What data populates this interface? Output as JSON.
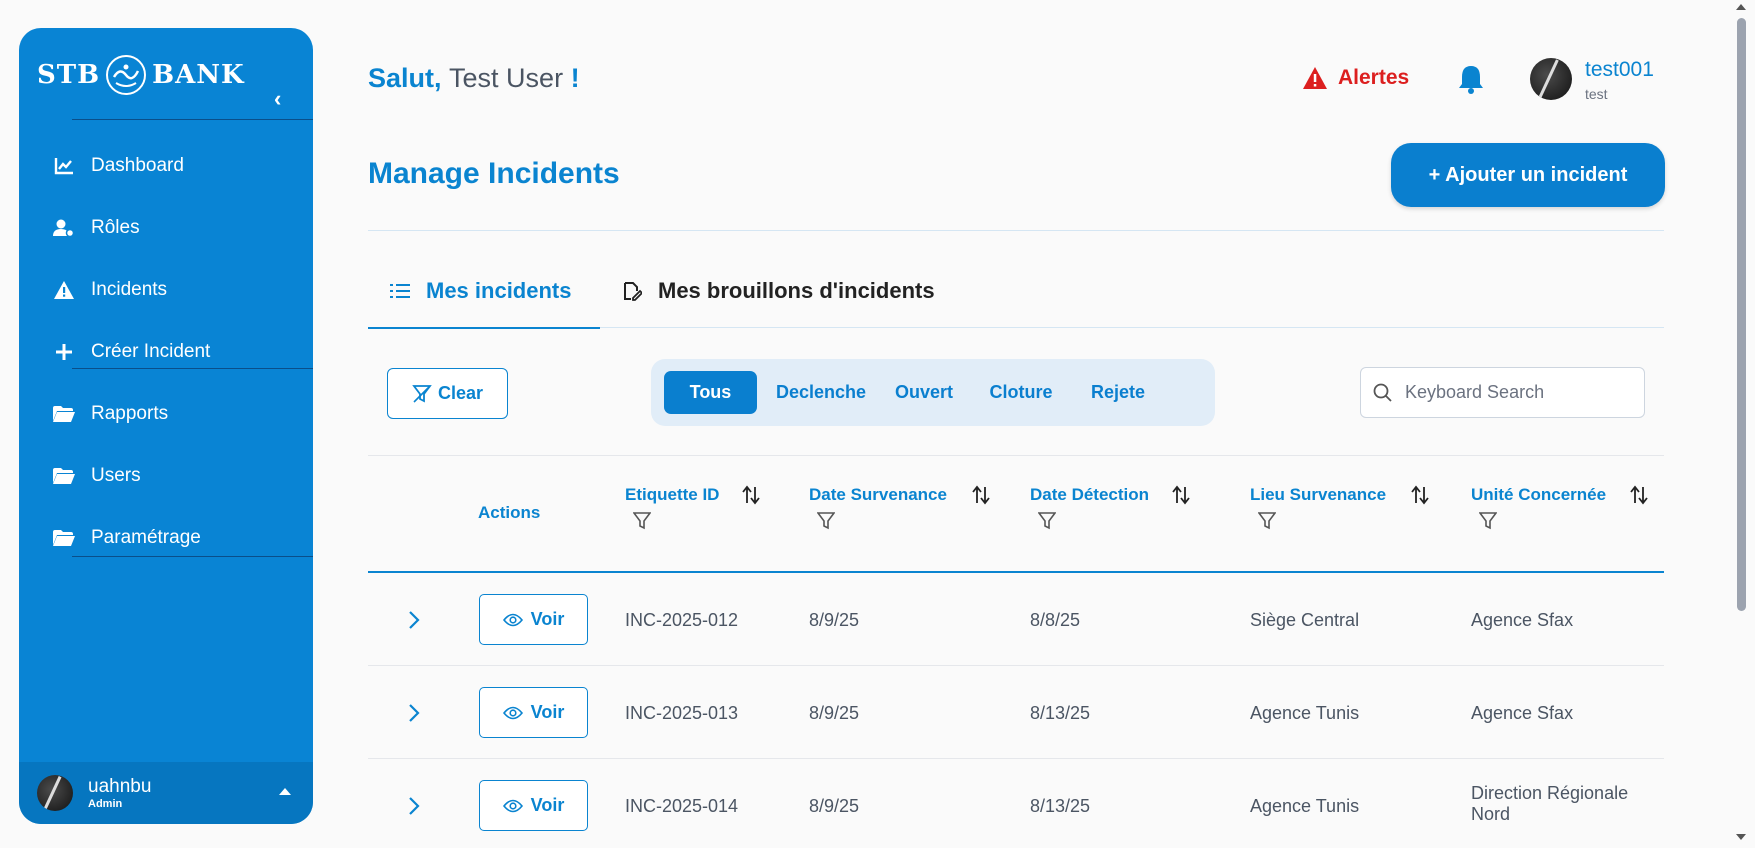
{
  "sidebar": {
    "logo_left": "STB",
    "logo_right": "BANK",
    "items": [
      {
        "label": "Dashboard",
        "icon": "chart-line-icon"
      },
      {
        "label": "Rôles",
        "icon": "user-gear-icon"
      },
      {
        "label": "Incidents",
        "icon": "warning-icon"
      },
      {
        "label": "Créer Incident",
        "icon": "plus-icon"
      },
      {
        "label": "Rapports",
        "icon": "folder-icon"
      },
      {
        "label": "Users",
        "icon": "folder-icon"
      },
      {
        "label": "Paramétrage",
        "icon": "folder-icon"
      }
    ],
    "footer": {
      "name": "uahnbu",
      "role": "Admin"
    }
  },
  "header": {
    "greeting": "Salut,",
    "user": "Test User",
    "exclaim": "!",
    "alerts_label": "Alertes",
    "profile_name": "test001",
    "profile_sub": "test"
  },
  "page": {
    "title": "Manage Incidents",
    "add_label": "+ Ajouter un incident"
  },
  "tabs": [
    {
      "label": "Mes incidents",
      "active": true
    },
    {
      "label": "Mes brouillons d'incidents",
      "active": false
    }
  ],
  "toolbar": {
    "clear_label": "Clear",
    "filters": [
      "Tous",
      "Declenche",
      "Ouvert",
      "Cloture",
      "Rejete"
    ],
    "active_filter": "Tous",
    "search_placeholder": "Keyboard Search"
  },
  "table": {
    "columns": [
      "Actions",
      "Etiquette ID",
      "Date Survenance",
      "Date Détection",
      "Lieu Survenance",
      "Unité Concernée"
    ],
    "voir_label": "Voir",
    "rows": [
      {
        "id": "INC-2025-012",
        "survenance": "8/9/25",
        "detection": "8/8/25",
        "lieu": "Siège Central",
        "unite": "Agence Sfax"
      },
      {
        "id": "INC-2025-013",
        "survenance": "8/9/25",
        "detection": "8/13/25",
        "lieu": "Agence Tunis",
        "unite": "Agence Sfax"
      },
      {
        "id": "INC-2025-014",
        "survenance": "8/9/25",
        "detection": "8/13/25",
        "lieu": "Agence Tunis",
        "unite": "Direction Régionale Nord"
      }
    ]
  },
  "colors": {
    "primary": "#0a84d0",
    "sidebar": "#0984d4",
    "alert": "#dc1f1f"
  }
}
